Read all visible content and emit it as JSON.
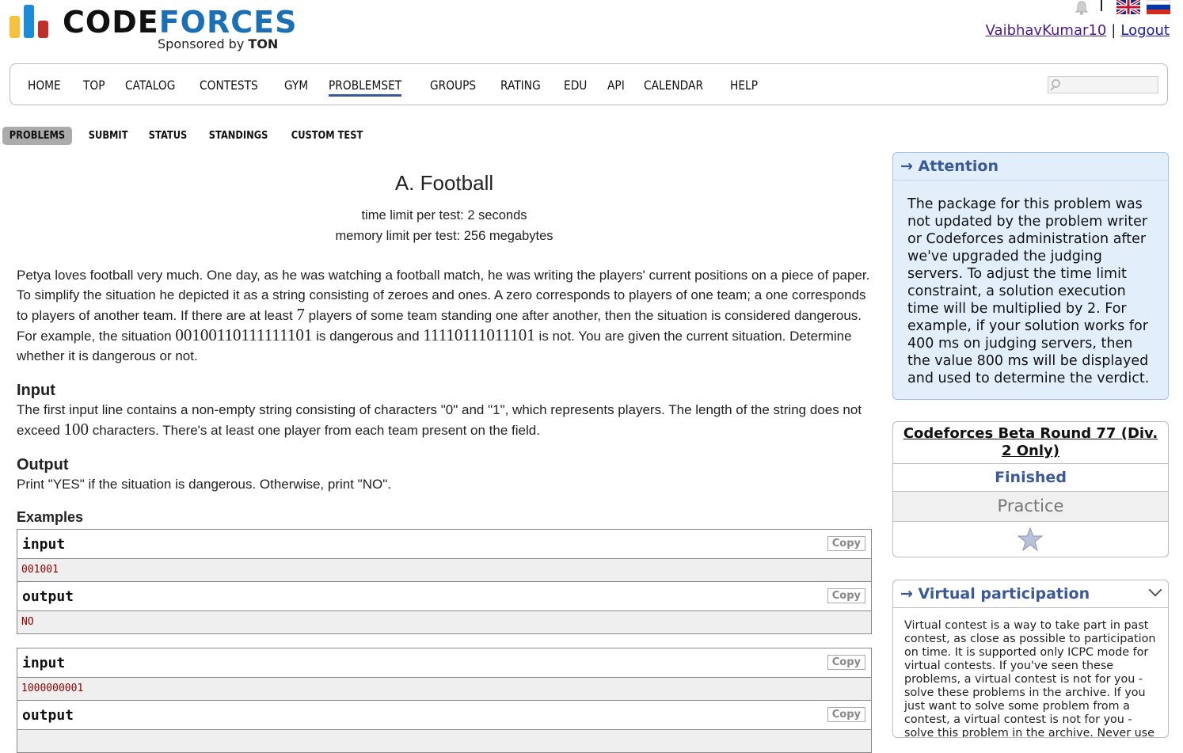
{
  "header": {
    "logo": {
      "word_part1": "CODE",
      "word_part2": "FORCES",
      "sponsored_prefix": "Sponsored by",
      "sponsor": "TON"
    },
    "icons": [
      "bell-icon",
      "uk-flag-icon",
      "ru-flag-icon"
    ],
    "user": {
      "handle": "VaibhavKumar10",
      "separator": "|",
      "logout_label": "Logout"
    }
  },
  "menu": {
    "items": [
      "HOME",
      "TOP",
      "CATALOG",
      "CONTESTS",
      "GYM",
      "PROBLEMSET",
      "GROUPS",
      "RATING",
      "EDU",
      "API",
      "CALENDAR",
      "HELP"
    ],
    "active": "PROBLEMSET",
    "search_placeholder": ""
  },
  "second_menu": {
    "items": [
      "PROBLEMS",
      "SUBMIT",
      "STATUS",
      "STANDINGS",
      "CUSTOM TEST"
    ],
    "active": "PROBLEMS"
  },
  "problem": {
    "title": "A. Football",
    "time_limit": "time limit per test: 2 seconds",
    "memory_limit": "memory limit per test: 256 megabytes",
    "legend_parts": [
      "Petya loves football very much. One day, as he was watching a football match, he was writing the players' current positions on a piece of paper. To simplify the situation he depicted it as a string consisting of zeroes and ones. A zero corresponds to players of one team; a one corresponds to players of another team. If there are at least ",
      "7",
      " players of some team standing one after another, then the situation is considered dangerous. For example, the situation ",
      "00100110111111101",
      " is dangerous and ",
      "11110111011101",
      " is not. You are given the current situation. Determine whether it is dangerous or not."
    ],
    "input_title": "Input",
    "input_parts": [
      "The first input line contains a non-empty string consisting of characters \"0\" and \"1\", which represents players. The length of the string does not exceed ",
      "100",
      " characters. There's at least one player from each team present on the field."
    ],
    "output_title": "Output",
    "output_text": "Print \"YES\" if the situation is dangerous. Otherwise, print \"NO\".",
    "examples_title": "Examples",
    "examples": [
      {
        "input_label": "input",
        "input": "001001",
        "output_label": "output",
        "output": "NO",
        "copy_label": "Copy"
      },
      {
        "input_label": "input",
        "input": "1000000001",
        "output_label": "output",
        "output": "",
        "copy_label": "Copy"
      }
    ]
  },
  "sidebar": {
    "attention": {
      "caption": "→ Attention",
      "text": "The package for this problem was not updated by the problem writer or Codeforces administration after we've upgraded the judging servers. To adjust the time limit constraint, a solution execution time will be multiplied by 2. For example, if your solution works for 400 ms on judging servers, then the value 800 ms will be displayed and used to determine the verdict."
    },
    "round": {
      "name": "Codeforces Beta Round 77 (Div. 2 Only)",
      "status": "Finished",
      "mode": "Practice",
      "star_icon": "star-icon"
    },
    "virtual": {
      "caption": "→ Virtual participation",
      "text": "Virtual contest is a way to take part in past contest, as close as possible to participation on time. It is supported only ICPC mode for virtual contests. If you've seen these problems, a virtual contest is not for you - solve these problems in the archive. If you just want to solve some problem from a contest, a virtual contest is not for you - solve this problem in the archive. Never use someone else's code, read the tutorials or communicate with other person during a virtual contest."
    }
  },
  "colors": {
    "accent": "#3b5998",
    "attention_bg": "#e2effb",
    "sample_text": "#8b0000",
    "logo_yellow": "#f6c23e",
    "logo_blue": "#1a8cd8",
    "logo_red": "#c0302a"
  }
}
